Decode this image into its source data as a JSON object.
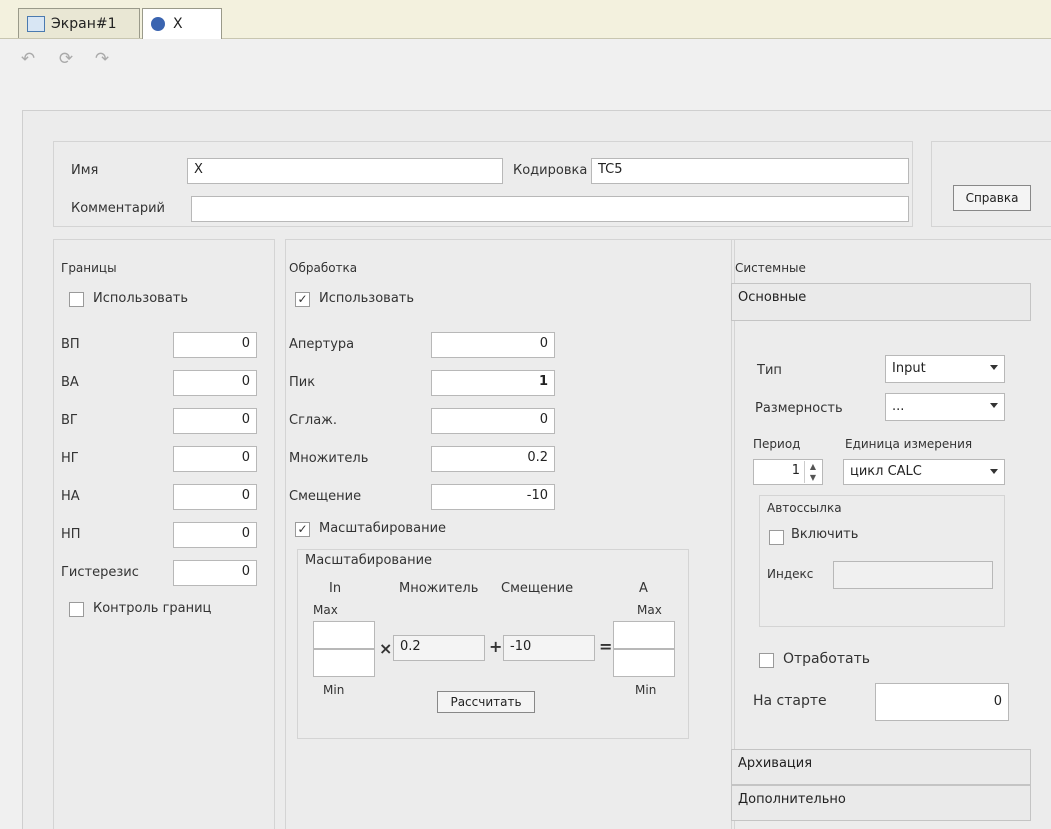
{
  "tabs": [
    {
      "label": "Экран#1"
    },
    {
      "label": "X"
    }
  ],
  "header": {
    "name_label": "Имя",
    "name_value": "X",
    "encoding_label": "Кодировка",
    "encoding_value": "TC5",
    "comment_label": "Комментарий",
    "comment_value": "",
    "help_button": "Справка"
  },
  "bounds": {
    "title": "Границы",
    "use_label": "Использовать",
    "use_checked": false,
    "rows": [
      {
        "label": "ВП",
        "value": "0"
      },
      {
        "label": "ВА",
        "value": "0"
      },
      {
        "label": "ВГ",
        "value": "0"
      },
      {
        "label": "НГ",
        "value": "0"
      },
      {
        "label": "НА",
        "value": "0"
      },
      {
        "label": "НП",
        "value": "0"
      },
      {
        "label": "Гистерезис",
        "value": "0"
      }
    ],
    "control_label": "Контроль границ",
    "control_checked": false
  },
  "processing": {
    "title": "Обработка",
    "use_label": "Использовать",
    "use_checked": true,
    "rows": [
      {
        "label": "Апертура",
        "value": "0"
      },
      {
        "label": "Пик",
        "value": "1"
      },
      {
        "label": "Сглаж.",
        "value": "0"
      },
      {
        "label": "Множитель",
        "value": "0.2"
      },
      {
        "label": "Смещение",
        "value": "-10"
      }
    ],
    "scaling_check_label": "Масштабирование",
    "scaling_checked": true,
    "scaling": {
      "title": "Масштабирование",
      "in_label": "In",
      "mult_label": "Множитель",
      "offset_label": "Смещение",
      "a_label": "A",
      "max_left": "Max",
      "max_right": "Max",
      "min_left": "Min",
      "min_right": "Min",
      "mult_value": "0.2",
      "offset_value": "-10",
      "times": "×",
      "plus": "+",
      "equals": "=",
      "calc_button": "Рассчитать"
    }
  },
  "system": {
    "title": "Системные",
    "basic_section": "Основные",
    "type_label": "Тип",
    "type_value": "Input",
    "dim_label": "Размерность",
    "dim_value": "...",
    "period_label": "Период",
    "unit_label": "Единица измерения",
    "period_value": "1",
    "unit_value": "цикл CALC",
    "autolink_title": "Автоссылка",
    "autolink_enable_label": "Включить",
    "autolink_enable_checked": false,
    "index_label": "Индекс",
    "index_value": "",
    "process_label": "Отработать",
    "process_checked": false,
    "start_label": "На старте",
    "start_value": "0",
    "archiving_section": "Архивация",
    "additional_section": "Дополнительно"
  }
}
